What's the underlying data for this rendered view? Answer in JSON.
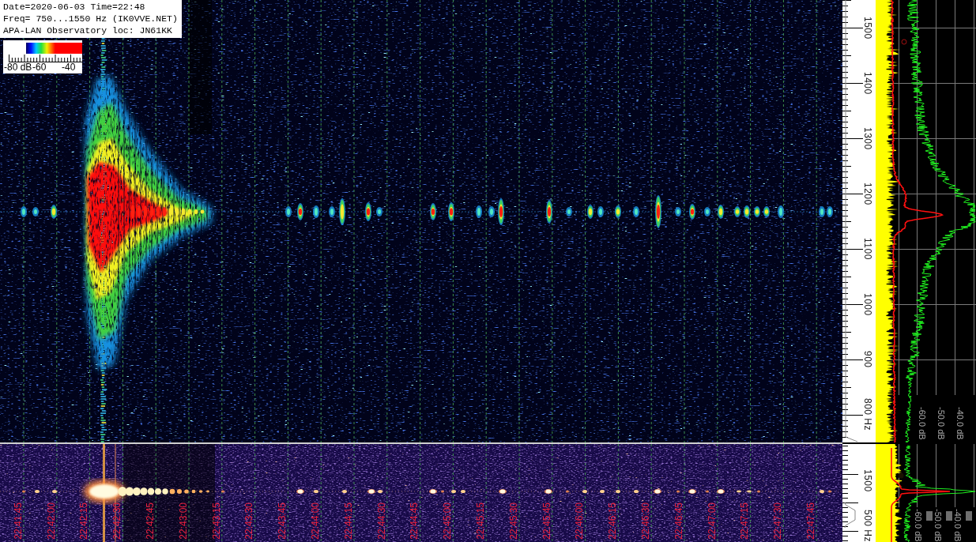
{
  "info_box": {
    "lines": [
      "Date=2020-06-03 Time=22:48",
      "Freq= 750...1550 Hz (IK0VVE.NET)",
      "APA-LAN Observatory loc: JN61KK"
    ]
  },
  "color_legend": {
    "labels": [
      "-80 dB",
      "-60",
      "-40"
    ]
  },
  "main_view": {
    "frequency_labels": [
      "1500",
      "1400",
      "1300",
      "1200",
      "1100",
      "1000",
      "900",
      "800 Hz"
    ],
    "spectrum_labels": [
      "-60.0 dB",
      "-50.0 dB",
      "-40.0 dB"
    ]
  },
  "detail_view": {
    "time_labels": [
      "22:41:45",
      "22:42:00",
      "22:42:15",
      "22:42:30",
      "22:42:45",
      "22:43:00",
      "22:43:15",
      "22:43:30",
      "22:43:45",
      "22:44:00",
      "22:44:15",
      "22:44:30",
      "22:44:45",
      "22:45:00",
      "22:45:15",
      "22:45:30",
      "22:45:45",
      "22:46:00",
      "22:46:15",
      "22:46:30",
      "22:46:45",
      "22:47:00",
      "22:47:15",
      "22:47:30",
      "22:47:45"
    ],
    "frequency_labels": [
      "1500",
      "500 Hz"
    ],
    "spectrum_labels": [
      "-60.0 dB",
      "-50.0 dB",
      "-40.0 dB"
    ]
  }
}
